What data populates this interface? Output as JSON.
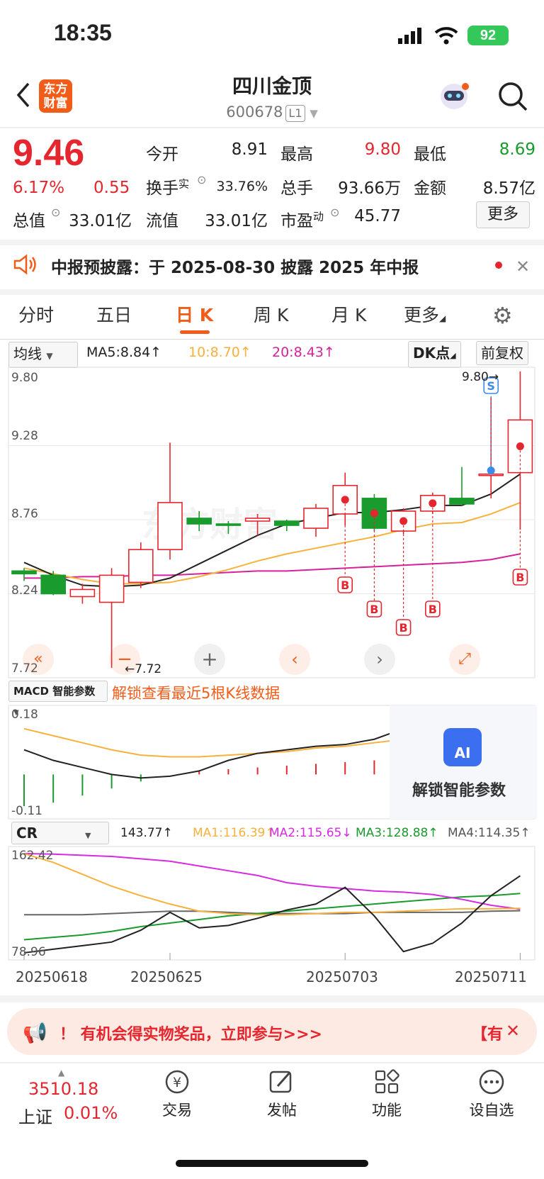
{
  "status_bar": {
    "time": "18:35",
    "battery": "92"
  },
  "header": {
    "title": "四川金顶",
    "code": "600678",
    "level": "L1",
    "logo_line1": "东方",
    "logo_line2": "财富"
  },
  "quote": {
    "price": "9.46",
    "change_pct": "6.17%",
    "change": "0.55",
    "open_label": "今开",
    "open": "8.91",
    "high_label": "最高",
    "high": "9.80",
    "low_label": "最低",
    "low": "8.69",
    "turnover_label": "换手",
    "turnover_sup": "实",
    "turnover": "33.76%",
    "volume_label": "总手",
    "volume": "93.66万",
    "amount_label": "金额",
    "amount": "8.57亿",
    "mktcap_label": "总值",
    "mktcap": "33.01亿",
    "float_label": "流值",
    "float": "33.01亿",
    "pe_label": "市盈",
    "pe_sup": "动",
    "pe": "45.77",
    "more": "更多"
  },
  "notice": {
    "text": "中报预披露：于 2025-08-30 披露 2025 年中报"
  },
  "tabs": [
    "分时",
    "五日",
    "日 K",
    "周 K",
    "月 K",
    "更多"
  ],
  "kline_header": {
    "indicator": "均线",
    "ma5": "MA5:8.84↑",
    "ma10": "10:8.70↑",
    "ma20": "20:8.43↑",
    "dk": "DK点",
    "adjust": "前复权"
  },
  "kline_axis": {
    "y1": "9.80",
    "y2": "9.28",
    "y3": "8.76",
    "y4": "8.24",
    "y5": "7.72",
    "high_mark": "9.80→",
    "low_mark": "←7.72",
    "sell_tag": "S",
    "buy_tag": "B"
  },
  "macd": {
    "selector": "MACD 智能参数",
    "unlock_text": "解锁查看最近5根K线数据",
    "y_top": "0.18",
    "y_bottom": "-0.11",
    "ai_badge": "AI",
    "ai_label": "解锁智能参数"
  },
  "cr": {
    "selector": "CR",
    "value": "143.77↑",
    "ma1": "MA1:116.39↑",
    "ma2": "MA2:115.65↓",
    "ma3": "MA3:128.88↑",
    "ma4": "MA4:114.35↑",
    "y_top": "162.42",
    "y_bottom": "78.96"
  },
  "dates": [
    "20250618",
    "20250625",
    "20250703",
    "20250711"
  ],
  "promo": {
    "text": "！ 有机会得实物奖品，立即参与>>>",
    "tail": "【有"
  },
  "bottom_bar": {
    "index_value": "3510.18",
    "index_name": "上证",
    "index_change": "0.01%",
    "items": [
      "交易",
      "发帖",
      "功能",
      "设自选"
    ]
  },
  "colors": {
    "up": "#e5262e",
    "down": "#1a9b2d",
    "accent": "#f25c19",
    "ma5": "#222222",
    "ma10": "#f7b13c",
    "ma20": "#d6229a"
  },
  "chart_data": [
    {
      "type": "candlestick",
      "title": "日K",
      "y_range": [
        7.72,
        9.8
      ],
      "candles": [
        {
          "o": 8.4,
          "c": 8.38,
          "h": 8.42,
          "l": 8.33
        },
        {
          "o": 8.37,
          "c": 8.24,
          "h": 8.4,
          "l": 8.23
        },
        {
          "o": 8.22,
          "c": 8.27,
          "h": 8.31,
          "l": 8.17
        },
        {
          "o": 8.18,
          "c": 8.37,
          "h": 8.42,
          "l": 7.72
        },
        {
          "o": 8.32,
          "c": 8.55,
          "h": 8.6,
          "l": 8.28
        },
        {
          "o": 8.55,
          "c": 8.88,
          "h": 9.3,
          "l": 8.48
        },
        {
          "o": 8.77,
          "c": 8.73,
          "h": 8.82,
          "l": 8.68
        },
        {
          "o": 8.73,
          "c": 8.72,
          "h": 8.75,
          "l": 8.66
        },
        {
          "o": 8.75,
          "c": 8.77,
          "h": 8.8,
          "l": 8.65
        },
        {
          "o": 8.75,
          "c": 8.72,
          "h": 8.76,
          "l": 8.68
        },
        {
          "o": 8.7,
          "c": 8.84,
          "h": 8.87,
          "l": 8.64
        },
        {
          "o": 8.8,
          "c": 9.0,
          "h": 9.09,
          "l": 8.72
        },
        {
          "o": 8.91,
          "c": 8.7,
          "h": 8.94,
          "l": 8.68
        },
        {
          "o": 8.68,
          "c": 8.82,
          "h": 8.84,
          "l": 8.66
        },
        {
          "o": 8.82,
          "c": 8.93,
          "h": 8.95,
          "l": 8.8
        },
        {
          "o": 8.91,
          "c": 8.87,
          "h": 9.13,
          "l": 8.86
        },
        {
          "o": 9.07,
          "c": 9.08,
          "h": 9.62,
          "l": 8.91
        },
        {
          "o": 9.09,
          "c": 9.46,
          "h": 9.8,
          "l": 8.69
        }
      ],
      "ma5": [
        8.46,
        8.37,
        8.3,
        8.29,
        8.3,
        8.35,
        8.45,
        8.55,
        8.65,
        8.73,
        8.77,
        8.81,
        8.81,
        8.83,
        8.86,
        8.86,
        8.94,
        9.08
      ],
      "ma10": [
        8.42,
        8.38,
        8.34,
        8.31,
        8.31,
        8.32,
        8.36,
        8.41,
        8.47,
        8.52,
        8.56,
        8.6,
        8.64,
        8.69,
        8.73,
        8.74,
        8.8,
        8.88
      ],
      "ma20": [
        8.35,
        8.35,
        8.36,
        8.36,
        8.37,
        8.37,
        8.38,
        8.39,
        8.4,
        8.4,
        8.41,
        8.42,
        8.43,
        8.44,
        8.45,
        8.46,
        8.48,
        8.52
      ],
      "buy_points": [
        11,
        12,
        13,
        14,
        17
      ],
      "sell_points": [
        16
      ]
    },
    {
      "type": "bar",
      "title": "MACD",
      "y_range": [
        -0.11,
        0.18
      ],
      "hist": [
        -0.09,
        -0.08,
        -0.06,
        -0.04,
        -0.02,
        0.0,
        0.01,
        0.015,
        0.02,
        0.025,
        0.03,
        0.035,
        0.04,
        0.045,
        0.05
      ],
      "dif": [
        0.07,
        0.04,
        0.02,
        0.0,
        -0.01,
        -0.005,
        0.01,
        0.04,
        0.06,
        0.07,
        0.08,
        0.085,
        0.1,
        0.13,
        0.125
      ],
      "dea": [
        0.13,
        0.11,
        0.09,
        0.07,
        0.055,
        0.05,
        0.05,
        0.055,
        0.06,
        0.065,
        0.075,
        0.08,
        0.09,
        0.1,
        0.11
      ]
    },
    {
      "type": "line",
      "title": "CR",
      "y_range": [
        78.96,
        162.42
      ],
      "cr": [
        79,
        82,
        85,
        88,
        98,
        113,
        100,
        102,
        108,
        115,
        120,
        134,
        110,
        80,
        87,
        104,
        127,
        143.77
      ],
      "ma1": [
        162.4,
        155,
        145,
        135,
        127,
        120,
        114,
        112,
        111,
        111,
        112,
        113,
        113,
        114,
        115,
        116,
        116,
        116.39
      ],
      "ma2": [
        162.4,
        162,
        161,
        160,
        158,
        156,
        152,
        148,
        144,
        138,
        135,
        133,
        131,
        130,
        128,
        124,
        119,
        115.65
      ],
      "ma3": [
        90,
        92,
        94,
        97,
        101,
        104,
        107,
        110,
        112,
        114,
        116,
        118,
        120,
        122,
        124,
        126,
        127,
        128.88
      ],
      "ma4": [
        111,
        111,
        111,
        112,
        113,
        114,
        114,
        113,
        112,
        112,
        112,
        112,
        113,
        113,
        113,
        113,
        114,
        114.35
      ]
    }
  ]
}
